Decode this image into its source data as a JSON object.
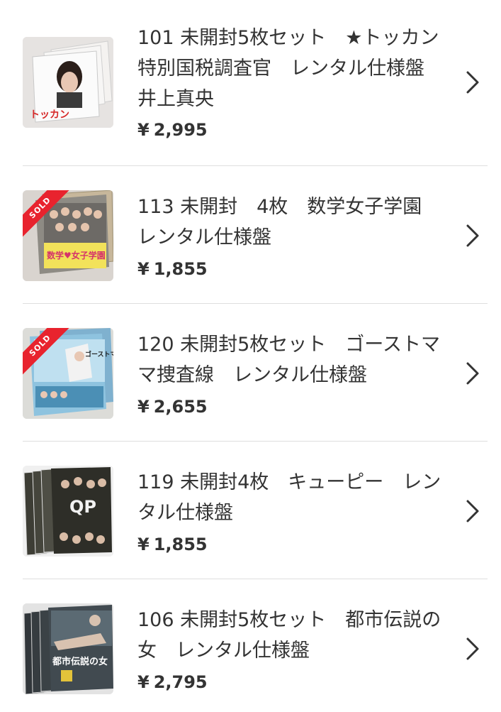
{
  "listings": [
    {
      "title": "101 未開封5枚セット　★トッカン　特別国税調査官　レンタル仕様盤　井上真央",
      "price": "2,995",
      "currency": "¥",
      "sold": false,
      "cover_text": "トッカン"
    },
    {
      "title": "113 未開封　4枚　数学女子学園　レンタル仕様盤",
      "price": "1,855",
      "currency": "¥",
      "sold": true,
      "sold_label": "SOLD",
      "cover_text": "数学♥女子学園"
    },
    {
      "title": "120 未開封5枚セット　ゴーストママ捜査線　レンタル仕様盤",
      "price": "2,655",
      "currency": "¥",
      "sold": true,
      "sold_label": "SOLD",
      "cover_text": "ゴーストママ捜査線"
    },
    {
      "title": "119 未開封4枚　キューピー　レンタル仕様盤",
      "price": "1,855",
      "currency": "¥",
      "sold": false,
      "cover_text": "QP"
    },
    {
      "title": "106 未開封5枚セット　都市伝説の女　レンタル仕様盤",
      "price": "2,795",
      "currency": "¥",
      "sold": false,
      "cover_text": "都市伝説の女"
    }
  ],
  "colors": {
    "text": "#333333",
    "divider": "#dedede",
    "sold_ribbon": "#e8232e",
    "chevron": "#333333"
  },
  "icons": {
    "row_arrow": "chevron-right-icon"
  }
}
